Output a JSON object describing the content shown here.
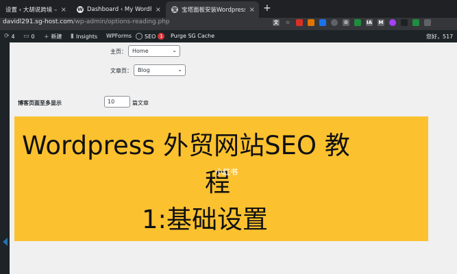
{
  "browser": {
    "tabs": [
      {
        "title": "设置 ‹ 大胡说跨境 — Word",
        "active": false
      },
      {
        "title": "Dashboard ‹ My WordPress —",
        "active": false
      },
      {
        "title": "宝塔面板安装Wordpress教程 - ",
        "active": true
      }
    ],
    "close_glyph": "×",
    "new_tab_glyph": "+",
    "url_host": "davidl291.sg-host.com",
    "url_path": "/wp-admin/options-reading.php"
  },
  "adminbar": {
    "updates_count": "4",
    "comments_count": "0",
    "new_label": "新建",
    "insights_label": "Insights",
    "wpforms_label": "WPForms",
    "seo_label": "SEO",
    "seo_badge": "1",
    "purge_label": "Purge SG Cache",
    "greeting": "您好，517"
  },
  "reading": {
    "homepage_label": "主页：",
    "homepage_value": "Home",
    "postspage_label": "文章页：",
    "postspage_value": "Blog",
    "posts_per_page_label": "博客页面至多显示",
    "posts_per_page_value": "10",
    "posts_per_page_suffix": "篇文章"
  },
  "banner": {
    "line1": "Wordpress 外贸网站SEO 教",
    "line2": "程",
    "line3": "1:基础设置",
    "watermark": "小红书"
  }
}
